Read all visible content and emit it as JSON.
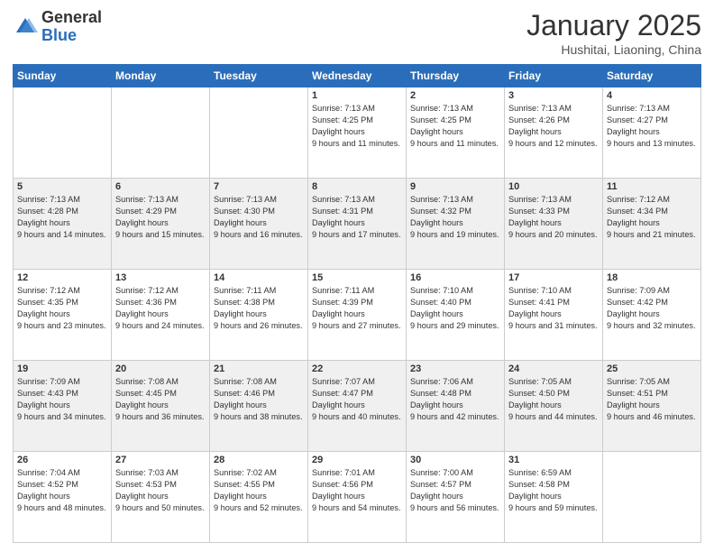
{
  "logo": {
    "general": "General",
    "blue": "Blue"
  },
  "header": {
    "month": "January 2025",
    "location": "Hushitai, Liaoning, China"
  },
  "weekdays": [
    "Sunday",
    "Monday",
    "Tuesday",
    "Wednesday",
    "Thursday",
    "Friday",
    "Saturday"
  ],
  "weeks": [
    [
      null,
      null,
      null,
      {
        "day": 1,
        "sunrise": "7:13 AM",
        "sunset": "4:25 PM",
        "daylight": "9 hours and 11 minutes."
      },
      {
        "day": 2,
        "sunrise": "7:13 AM",
        "sunset": "4:25 PM",
        "daylight": "9 hours and 11 minutes."
      },
      {
        "day": 3,
        "sunrise": "7:13 AM",
        "sunset": "4:26 PM",
        "daylight": "9 hours and 12 minutes."
      },
      {
        "day": 4,
        "sunrise": "7:13 AM",
        "sunset": "4:27 PM",
        "daylight": "9 hours and 13 minutes."
      }
    ],
    [
      {
        "day": 5,
        "sunrise": "7:13 AM",
        "sunset": "4:28 PM",
        "daylight": "9 hours and 14 minutes."
      },
      {
        "day": 6,
        "sunrise": "7:13 AM",
        "sunset": "4:29 PM",
        "daylight": "9 hours and 15 minutes."
      },
      {
        "day": 7,
        "sunrise": "7:13 AM",
        "sunset": "4:30 PM",
        "daylight": "9 hours and 16 minutes."
      },
      {
        "day": 8,
        "sunrise": "7:13 AM",
        "sunset": "4:31 PM",
        "daylight": "9 hours and 17 minutes."
      },
      {
        "day": 9,
        "sunrise": "7:13 AM",
        "sunset": "4:32 PM",
        "daylight": "9 hours and 19 minutes."
      },
      {
        "day": 10,
        "sunrise": "7:13 AM",
        "sunset": "4:33 PM",
        "daylight": "9 hours and 20 minutes."
      },
      {
        "day": 11,
        "sunrise": "7:12 AM",
        "sunset": "4:34 PM",
        "daylight": "9 hours and 21 minutes."
      }
    ],
    [
      {
        "day": 12,
        "sunrise": "7:12 AM",
        "sunset": "4:35 PM",
        "daylight": "9 hours and 23 minutes."
      },
      {
        "day": 13,
        "sunrise": "7:12 AM",
        "sunset": "4:36 PM",
        "daylight": "9 hours and 24 minutes."
      },
      {
        "day": 14,
        "sunrise": "7:11 AM",
        "sunset": "4:38 PM",
        "daylight": "9 hours and 26 minutes."
      },
      {
        "day": 15,
        "sunrise": "7:11 AM",
        "sunset": "4:39 PM",
        "daylight": "9 hours and 27 minutes."
      },
      {
        "day": 16,
        "sunrise": "7:10 AM",
        "sunset": "4:40 PM",
        "daylight": "9 hours and 29 minutes."
      },
      {
        "day": 17,
        "sunrise": "7:10 AM",
        "sunset": "4:41 PM",
        "daylight": "9 hours and 31 minutes."
      },
      {
        "day": 18,
        "sunrise": "7:09 AM",
        "sunset": "4:42 PM",
        "daylight": "9 hours and 32 minutes."
      }
    ],
    [
      {
        "day": 19,
        "sunrise": "7:09 AM",
        "sunset": "4:43 PM",
        "daylight": "9 hours and 34 minutes."
      },
      {
        "day": 20,
        "sunrise": "7:08 AM",
        "sunset": "4:45 PM",
        "daylight": "9 hours and 36 minutes."
      },
      {
        "day": 21,
        "sunrise": "7:08 AM",
        "sunset": "4:46 PM",
        "daylight": "9 hours and 38 minutes."
      },
      {
        "day": 22,
        "sunrise": "7:07 AM",
        "sunset": "4:47 PM",
        "daylight": "9 hours and 40 minutes."
      },
      {
        "day": 23,
        "sunrise": "7:06 AM",
        "sunset": "4:48 PM",
        "daylight": "9 hours and 42 minutes."
      },
      {
        "day": 24,
        "sunrise": "7:05 AM",
        "sunset": "4:50 PM",
        "daylight": "9 hours and 44 minutes."
      },
      {
        "day": 25,
        "sunrise": "7:05 AM",
        "sunset": "4:51 PM",
        "daylight": "9 hours and 46 minutes."
      }
    ],
    [
      {
        "day": 26,
        "sunrise": "7:04 AM",
        "sunset": "4:52 PM",
        "daylight": "9 hours and 48 minutes."
      },
      {
        "day": 27,
        "sunrise": "7:03 AM",
        "sunset": "4:53 PM",
        "daylight": "9 hours and 50 minutes."
      },
      {
        "day": 28,
        "sunrise": "7:02 AM",
        "sunset": "4:55 PM",
        "daylight": "9 hours and 52 minutes."
      },
      {
        "day": 29,
        "sunrise": "7:01 AM",
        "sunset": "4:56 PM",
        "daylight": "9 hours and 54 minutes."
      },
      {
        "day": 30,
        "sunrise": "7:00 AM",
        "sunset": "4:57 PM",
        "daylight": "9 hours and 56 minutes."
      },
      {
        "day": 31,
        "sunrise": "6:59 AM",
        "sunset": "4:58 PM",
        "daylight": "9 hours and 59 minutes."
      },
      null
    ]
  ]
}
